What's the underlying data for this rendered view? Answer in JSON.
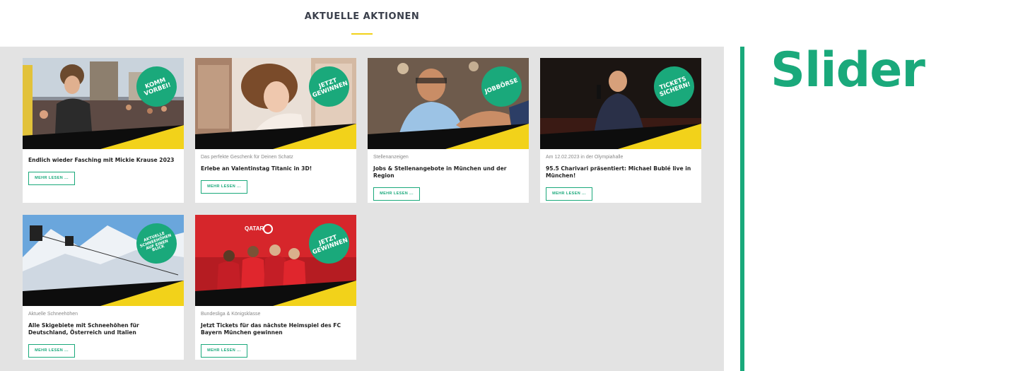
{
  "section": {
    "title": "AKTUELLE AKTIONEN"
  },
  "side": {
    "label": "Slider"
  },
  "colors": {
    "accent": "#1aa97b",
    "yellow": "#f2d21a",
    "grid_bg": "#e3e3e3"
  },
  "cards": [
    {
      "badge": "KOMM\nVORBEI!",
      "kicker": "",
      "title": "Endlich wieder Fasching mit Mickie Krause 2023",
      "button": "MEHR LESEN ..."
    },
    {
      "badge": "JETZT\nGEWINNEN",
      "kicker": "Das perfekte Geschenk für Deinen Schatz",
      "title": "Erlebe an Valentinstag Titanic in 3D!",
      "button": "MEHR LESEN ..."
    },
    {
      "badge": "JOBBÖRSE",
      "kicker": "Stellenanzeigen",
      "title": "Jobs & Stellenangebote in München und der Region",
      "button": "MEHR LESEN ..."
    },
    {
      "badge": "TICKETS\nSICHERN!",
      "kicker": "Am 12.02.2023 in der Olympiahalle",
      "title": "95.5 Charivari präsentiert: Michael Bublé live in München!",
      "button": "MEHR LESEN ..."
    },
    {
      "badge": "AKTUELLE\nSCHNEEHÖHEN\nAUF EINEN BLICK",
      "kicker": "Aktuelle Schneehöhen",
      "title": "Alle Skigebiete mit Schneehöhen für Deutschland, Österreich und Italien",
      "button": "MEHR LESEN ..."
    },
    {
      "badge": "JETZT\nGEWINNEN",
      "kicker": "Bundesliga & Königsklasse",
      "title": "Jetzt Tickets für das nächste Heimspiel des FC Bayern München gewinnen",
      "button": "MEHR LESEN ...",
      "image_text": "QATAR"
    }
  ]
}
